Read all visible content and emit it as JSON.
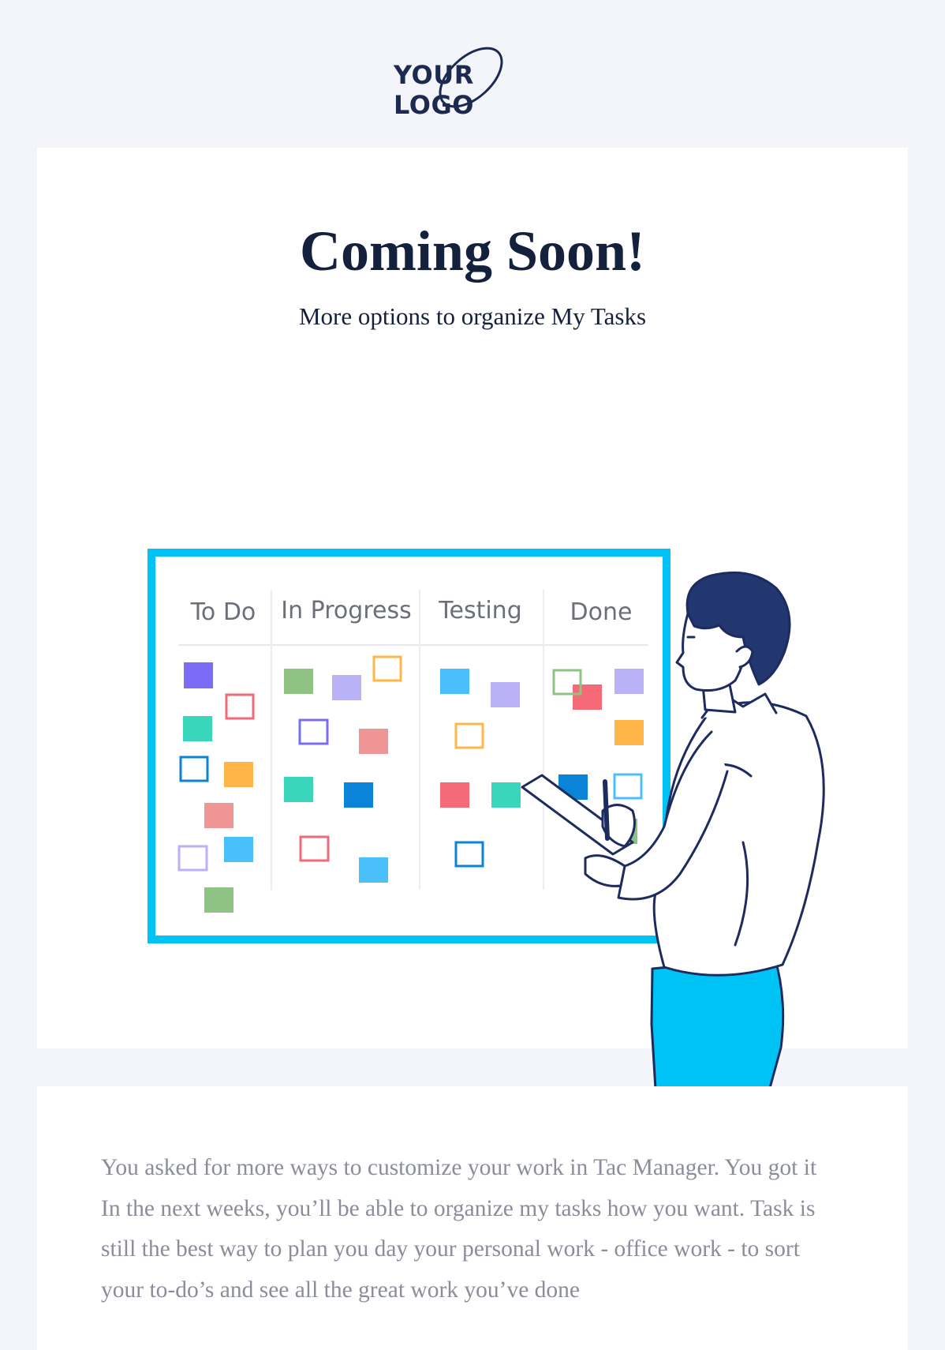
{
  "logo": {
    "text": "YOUR LOGO"
  },
  "hero": {
    "title": "Coming Soon!",
    "subtitle": "More options to organize My Tasks",
    "board": {
      "columns": [
        "To Do",
        "In Progress",
        "Testing",
        "Done"
      ]
    }
  },
  "body": {
    "paragraph": "You asked for more ways to customize your work in Tac Manager. You got it In the next weeks, you’ll be able to organize my tasks how you want. Task is still the best way to plan you day your personal work - office work - to sort your to-do’s and see all the great work you’ve done"
  },
  "colors": {
    "background": "#f4f5fa",
    "navy": "#14213d",
    "accent_blue": "#00c3f5",
    "text_gray": "#8a8d9a"
  }
}
